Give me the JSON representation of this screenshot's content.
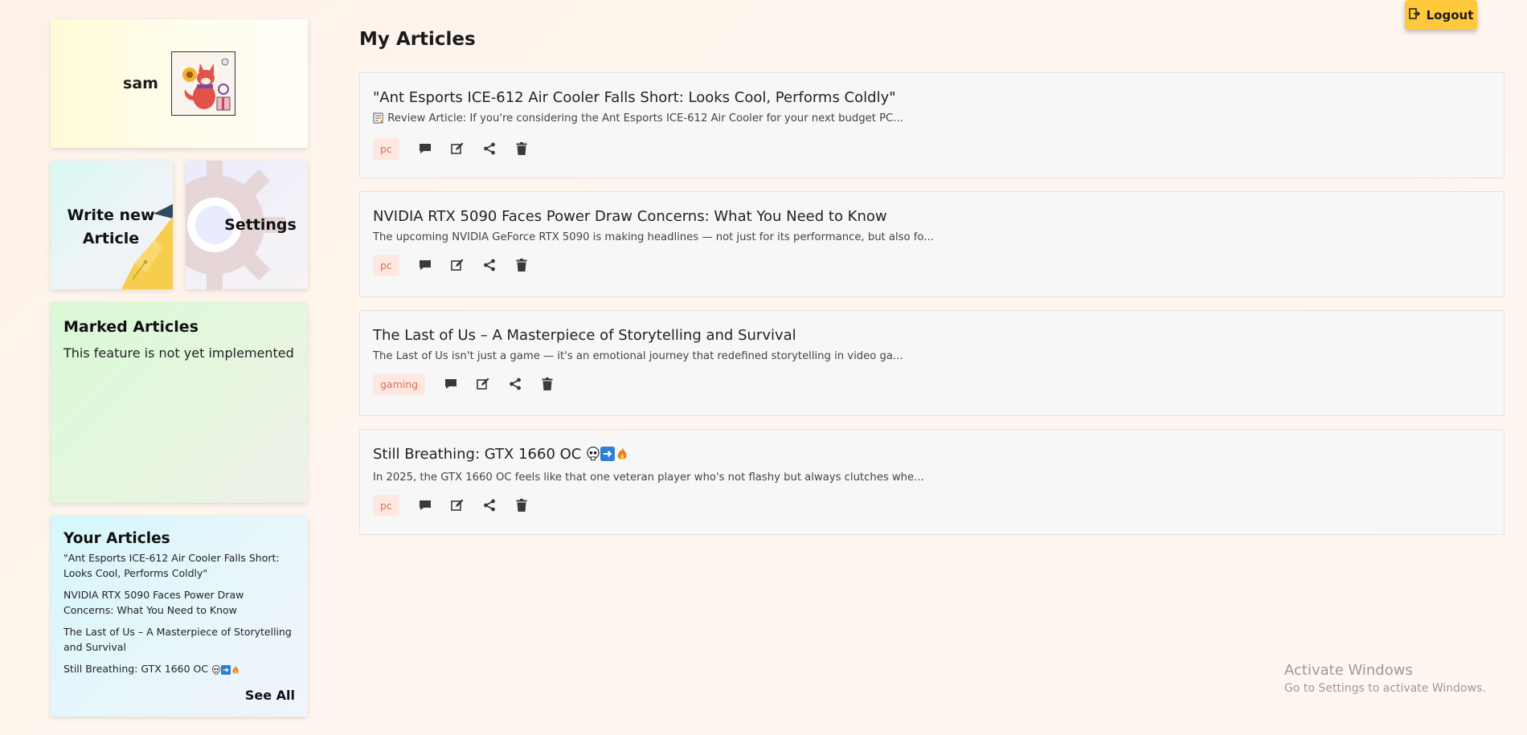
{
  "profile": {
    "name": "sam"
  },
  "actions": {
    "write_label": "Write new Article",
    "settings_label": "Settings"
  },
  "marked": {
    "title": "Marked Articles",
    "text": "This feature is not yet implemented"
  },
  "yours": {
    "title": "Your Articles",
    "items": [
      "\"Ant Esports ICE-612 Air Cooler Falls Short: Looks Cool, Performs Coldly\"",
      "NVIDIA RTX 5090 Faces Power Draw Concerns: What You Need to Know",
      "The Last of Us – A Masterpiece of Storytelling and Survival",
      "Still Breathing: GTX 1660 OC"
    ],
    "see_all": "See All"
  },
  "header": {
    "title": "My Articles",
    "logout_label": "Logout"
  },
  "articles": [
    {
      "title": "\"Ant Esports ICE-612 Air Cooler Falls Short: Looks Cool, Performs Coldly\"",
      "excerpt": "Review Article: If you're considering the Ant Esports ICE-612 Air Cooler for your next budget PC...",
      "tag": "pc"
    },
    {
      "title": "NVIDIA RTX 5090 Faces Power Draw Concerns: What You Need to Know",
      "excerpt": "The upcoming NVIDIA GeForce RTX 5090 is making headlines — not just for its performance, but also fo...",
      "tag": "pc"
    },
    {
      "title": "The Last of Us – A Masterpiece of Storytelling and Survival",
      "excerpt": "The Last of Us isn't just a game — it's an emotional journey that redefined storytelling in video ga...",
      "tag": "gaming"
    },
    {
      "title": "Still Breathing: GTX 1660 OC",
      "excerpt": "In 2025, the GTX 1660 OC feels like that one veteran player who's not flashy but always clutches whe...",
      "tag": "pc"
    }
  ],
  "icons": {
    "comment": "comment-icon",
    "edit": "edit-icon",
    "share": "share-icon",
    "delete": "trash-icon",
    "logout": "logout-icon",
    "emoji_sequence": [
      "skull-emoji",
      "right-arrow-emoji",
      "fire-emoji"
    ]
  },
  "colors": {
    "logout_bg": "#ffc83d",
    "tag_bg": "#fde9e2",
    "tag_text": "#e8694a"
  },
  "watermark": {
    "line1": "Activate Windows",
    "line2": "Go to Settings to activate Windows."
  }
}
